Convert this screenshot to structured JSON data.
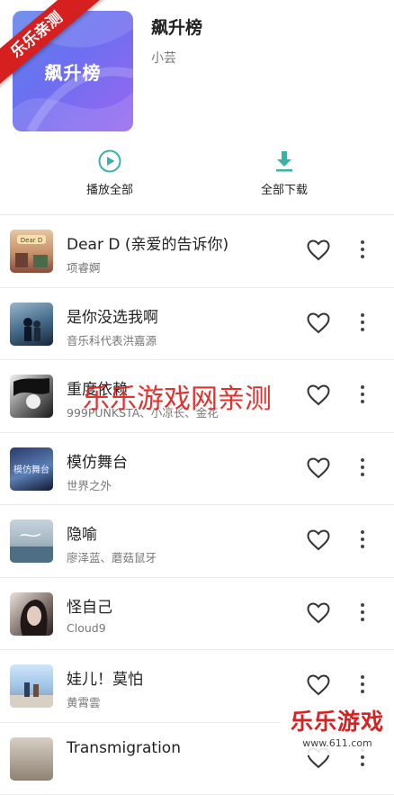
{
  "ribbon": {
    "label": "乐乐亲测"
  },
  "playlist": {
    "cover_text": "飙升榜",
    "title": "飙升榜",
    "owner": "小芸"
  },
  "actions": {
    "play_all": "播放全部",
    "download_all": "全部下载"
  },
  "colors": {
    "accent": "#39b3a6",
    "watermark_red": "#e0201d"
  },
  "songs": [
    {
      "title": "Dear D (亲爱的告诉你)",
      "artist": "项睿婀",
      "thumb_text": "Dear D"
    },
    {
      "title": "是你没选我啊",
      "artist": "音乐科代表洪嘉源"
    },
    {
      "title": "重度依赖",
      "artist": "999PUNKSTA、小凉长、金花"
    },
    {
      "title": "模仿舞台",
      "artist": "世界之外",
      "thumb_text": "模仿舞台"
    },
    {
      "title": "隐喻",
      "artist": "廖泽蓝、蘑菇鼠牙"
    },
    {
      "title": "怪自己",
      "artist": "Cloud9"
    },
    {
      "title": "娃儿！莫怕",
      "artist": "黄霄雲"
    },
    {
      "title": "Transmigration",
      "artist": ""
    }
  ],
  "watermarks": {
    "center": "乐乐游戏网亲测",
    "corner_title": "乐乐游戏",
    "corner_url": "www.611.com"
  }
}
